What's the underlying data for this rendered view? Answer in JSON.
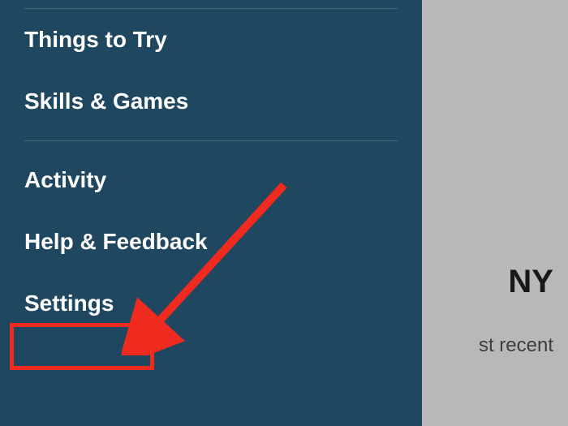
{
  "sidebar": {
    "items": [
      {
        "label": "Things to Try"
      },
      {
        "label": "Skills & Games"
      },
      {
        "label": "Activity"
      },
      {
        "label": "Help & Feedback"
      },
      {
        "label": "Settings"
      }
    ]
  },
  "background": {
    "partial_heading": "NY",
    "partial_subtext": "st recent"
  },
  "annotation": {
    "highlight_target": "settings",
    "arrow_color": "#ef2a1f"
  }
}
